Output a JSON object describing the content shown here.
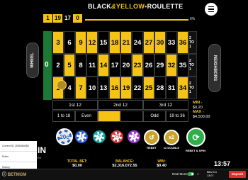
{
  "header": {
    "history": [
      {
        "value": "1",
        "color": "yellow"
      },
      {
        "value": "19",
        "color": "yellow"
      },
      {
        "value": "17",
        "color": "black"
      },
      {
        "value": "0",
        "color": "yellow"
      }
    ],
    "title_part1": "BLACK",
    "title_amp": "&",
    "title_part2": "YELLOW",
    "title_sep": "•",
    "title_part3": "ROULETTE",
    "progress_percent": 100,
    "progress_label": "0%"
  },
  "sidebar": {
    "wheel_label": "WHEEL",
    "neighbors_label": "NEIGHBORS"
  },
  "table": {
    "zero": "0",
    "rows": [
      [
        {
          "n": "3",
          "c": "Y"
        },
        {
          "n": "6",
          "c": "K"
        },
        {
          "n": "9",
          "c": "Y"
        },
        {
          "n": "12",
          "c": "Y"
        },
        {
          "n": "15",
          "c": "K"
        },
        {
          "n": "18",
          "c": "Y"
        },
        {
          "n": "21",
          "c": "Y"
        },
        {
          "n": "24",
          "c": "K"
        },
        {
          "n": "27",
          "c": "Y"
        },
        {
          "n": "30",
          "c": "Y"
        },
        {
          "n": "33",
          "c": "K"
        },
        {
          "n": "36",
          "c": "Y"
        }
      ],
      [
        {
          "n": "2",
          "c": "K"
        },
        {
          "n": "5",
          "c": "Y"
        },
        {
          "n": "8",
          "c": "K"
        },
        {
          "n": "11",
          "c": "K"
        },
        {
          "n": "14",
          "c": "Y"
        },
        {
          "n": "17",
          "c": "K"
        },
        {
          "n": "20",
          "c": "K"
        },
        {
          "n": "23",
          "c": "Y"
        },
        {
          "n": "26",
          "c": "K"
        },
        {
          "n": "29",
          "c": "K"
        },
        {
          "n": "32",
          "c": "Y"
        },
        {
          "n": "35",
          "c": "K"
        }
      ],
      [
        {
          "n": "1",
          "c": "Y"
        },
        {
          "n": "4",
          "c": "K"
        },
        {
          "n": "7",
          "c": "Y"
        },
        {
          "n": "10",
          "c": "K"
        },
        {
          "n": "13",
          "c": "K"
        },
        {
          "n": "16",
          "c": "Y"
        },
        {
          "n": "19",
          "c": "Y"
        },
        {
          "n": "22",
          "c": "K"
        },
        {
          "n": "25",
          "c": "Y"
        },
        {
          "n": "28",
          "c": "K"
        },
        {
          "n": "31",
          "c": "K"
        },
        {
          "n": "34",
          "c": "Y"
        }
      ]
    ],
    "columns": [
      "2 TO 1",
      "2 TO 1",
      "2 TO 1"
    ],
    "dozens": [
      "1st 12",
      "2nd 12",
      "3rd 12"
    ],
    "outside": [
      "1 to 18",
      "Even",
      "",
      "",
      "Odd",
      "19 to 36"
    ]
  },
  "limits": {
    "min_label": "MIN -",
    "min_value": "$0.20",
    "max_label": "MAX -",
    "max_value": "$4,500.00"
  },
  "chips": [
    {
      "label": "20c",
      "color": "#e8e8e8",
      "accent": "#1f5fbf",
      "selected": true
    },
    {
      "label": "1",
      "color": "#ffffff",
      "accent": "#2c5fd0"
    },
    {
      "label": "5",
      "color": "#ffffff",
      "accent": "#15a3a3"
    },
    {
      "label": "25",
      "color": "#ffffff",
      "accent": "#d13a3a"
    },
    {
      "label": "1",
      "color": "#ffffff",
      "accent": "#9d3ccf"
    }
  ],
  "controls": {
    "undo_label": "REBET",
    "double_label": "x2 DOUBLE",
    "x2_text": "x2",
    "respin_label": "REBET & SPIN"
  },
  "dropdown": {
    "items": [
      "Current ID: 2505484058",
      "Rules",
      "History"
    ]
  },
  "recent_text": "IN",
  "recent_sub": "BS",
  "footer": {
    "brand": "BETMGM",
    "total_bet_label": "TOTAL BET:",
    "total_bet_value": "$0.00",
    "balance_label": "BALANCE:",
    "balance_value": "$2,316,072.55",
    "win_label": "WIN:",
    "win_value": "$0.40",
    "real_money_label": "Real Money",
    "balance_small": "Bills Ero",
    "time_small": "13:07",
    "deposit_label": "Deposit",
    "clock": "13:57"
  }
}
